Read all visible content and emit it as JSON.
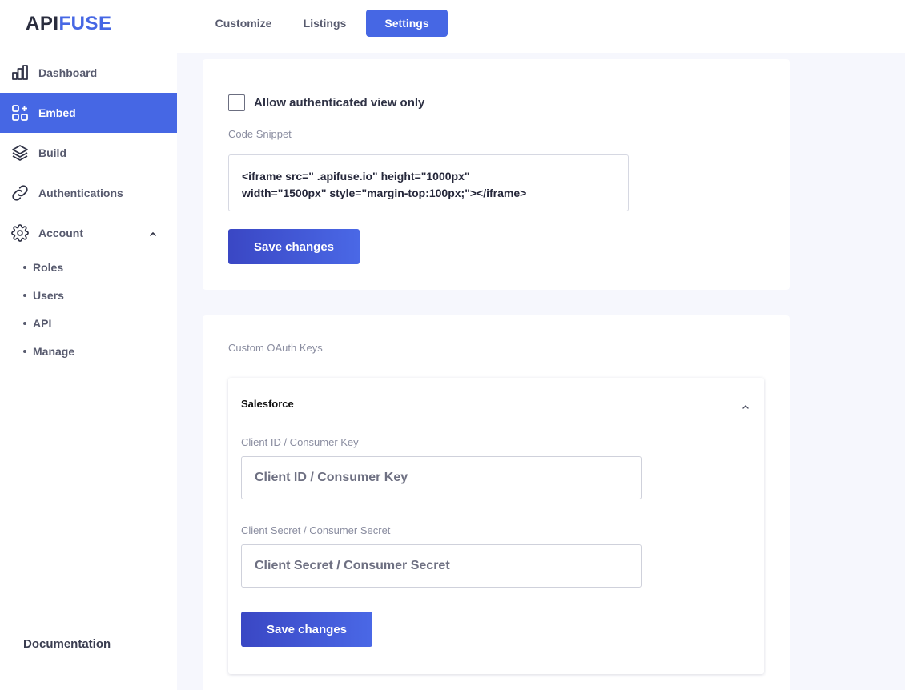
{
  "brand": {
    "part1": "API",
    "part2": "FUSE"
  },
  "sidebar": {
    "items": [
      {
        "label": "Dashboard",
        "icon": "bar-chart-icon"
      },
      {
        "label": "Embed",
        "icon": "grid-plus-icon",
        "active": true
      },
      {
        "label": "Build",
        "icon": "layers-icon"
      },
      {
        "label": "Authentications",
        "icon": "link-icon"
      },
      {
        "label": "Account",
        "icon": "gear-icon",
        "expanded": true
      }
    ],
    "account_subitems": [
      "Roles",
      "Users",
      "API",
      "Manage"
    ],
    "documentation": "Documentation"
  },
  "tabs": [
    {
      "label": "Customize"
    },
    {
      "label": "Listings"
    },
    {
      "label": "Settings",
      "active": true
    }
  ],
  "embed_settings": {
    "auth_view_label": "Allow authenticated view only",
    "auth_view_checked": false,
    "snippet_label": "Code Snippet",
    "snippet_line1": "<iframe src=\"                        .apifuse.io\" height=\"1000px\"",
    "snippet_line2": "width=\"1500px\" style=\"margin-top:100px;\"></iframe>",
    "save_label": "Save changes"
  },
  "oauth": {
    "section_label": "Custom OAuth Keys",
    "provider": "Salesforce",
    "client_id_label": "Client ID / Consumer Key",
    "client_id_placeholder": "Client ID / Consumer Key",
    "client_secret_label": "Client Secret / Consumer Secret",
    "client_secret_placeholder": "Client Secret / Consumer Secret",
    "save_label": "Save changes"
  },
  "colors": {
    "accent": "#4667e4",
    "button_gradient_start": "#3a47c4",
    "page_bg": "#f6f7fd"
  }
}
